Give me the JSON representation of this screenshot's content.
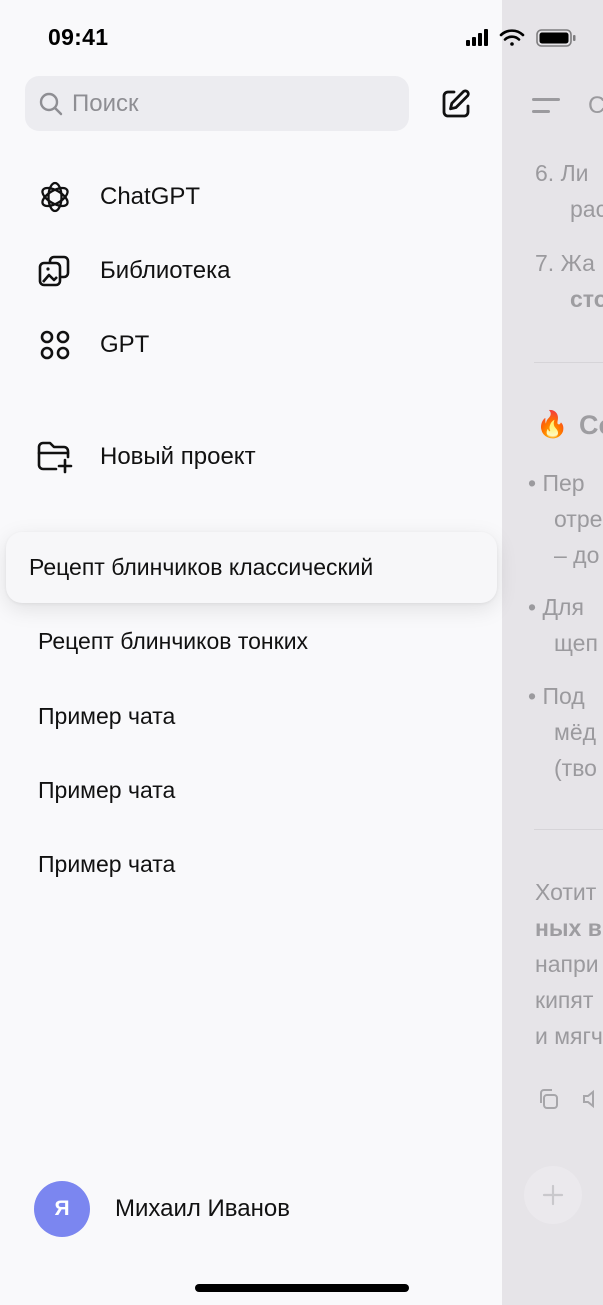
{
  "status_bar": {
    "time": "09:41"
  },
  "sidebar": {
    "search": {
      "placeholder": "Поиск",
      "value": ""
    },
    "nav": [
      {
        "label": "ChatGPT",
        "icon": "openai-logo-icon"
      },
      {
        "label": "Библиотека",
        "icon": "library-icon"
      },
      {
        "label": "GPT",
        "icon": "grid-dots-icon"
      }
    ],
    "new_project": {
      "label": "Новый проект",
      "icon": "folder-plus-icon"
    },
    "chats": [
      {
        "title": "Рецепт блинчиков классический",
        "active": true
      },
      {
        "title": "Рецепт блинчиков тонких",
        "active": false
      },
      {
        "title": "Пример чата",
        "active": false
      },
      {
        "title": "Пример чата",
        "active": false
      },
      {
        "title": "Пример чата",
        "active": false
      }
    ],
    "profile": {
      "initial": "Я",
      "name": "Михаил Иванов",
      "avatar_color": "#7b86f0"
    }
  },
  "chat_preview": {
    "header_text": "С",
    "lines": [
      "6. Ли",
      "рас",
      "7. Жа",
      "сто",
      "Со",
      "• Пер",
      "отре",
      "– до",
      "• Для",
      "щеп",
      "• Под",
      "мёд",
      "(тво",
      "Хотит",
      "ных в",
      "напри",
      "кипят",
      "и мягч"
    ],
    "emoji": "🔥"
  }
}
